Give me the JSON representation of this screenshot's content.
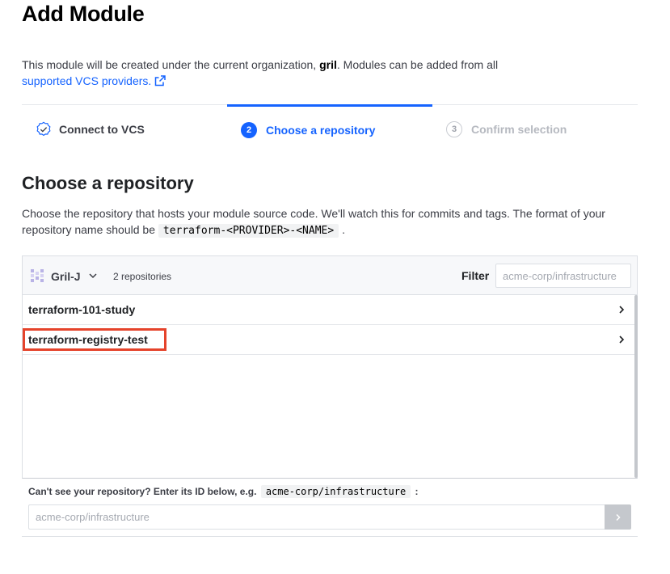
{
  "page": {
    "title": "Add Module"
  },
  "intro": {
    "text_before": "This module will be created under the current organization, ",
    "org": "gril",
    "text_after": ". Modules can be added from all",
    "link": "supported VCS providers."
  },
  "steps": [
    {
      "number": "",
      "label": "Connect to VCS",
      "state": "complete"
    },
    {
      "number": "2",
      "label": "Choose a repository",
      "state": "active"
    },
    {
      "number": "3",
      "label": "Confirm selection",
      "state": "upcoming"
    }
  ],
  "section": {
    "title": "Choose a repository",
    "desc_before": "Choose the repository that hosts your module source code. We'll watch this for commits and tags. The format of your repository name should be ",
    "desc_code": "terraform-<PROVIDER>-<NAME>",
    "desc_after": " ."
  },
  "repos": {
    "org_name": "Gril-J",
    "count": "2 repositories",
    "filter_label": "Filter",
    "filter_placeholder": "acme-corp/infrastructure",
    "items": [
      {
        "name": "terraform-101-study"
      },
      {
        "name": "terraform-registry-test",
        "highlighted": true
      }
    ]
  },
  "manual": {
    "label_before": "Can't see your repository? Enter its ID below, e.g. ",
    "label_code": "acme-corp/infrastructure",
    "label_after": ":",
    "placeholder": "acme-corp/infrastructure"
  },
  "colors": {
    "accent": "#1563ff",
    "highlight": "#e5432b"
  }
}
